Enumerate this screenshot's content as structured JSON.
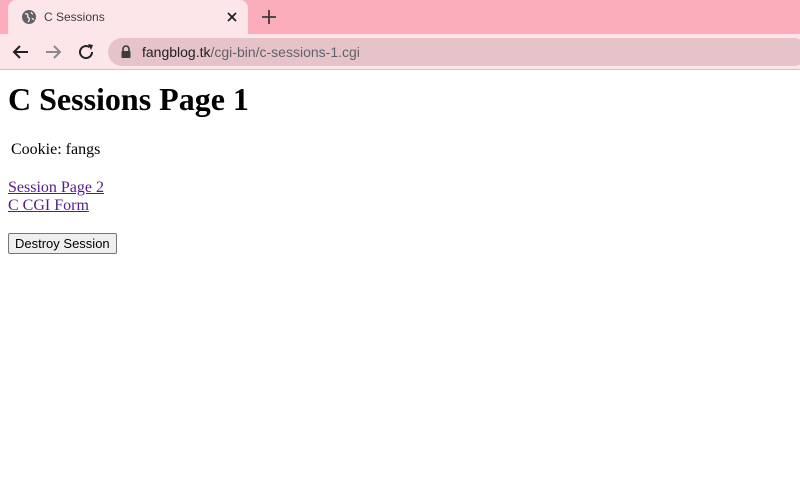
{
  "browser": {
    "tab": {
      "title": "C Sessions",
      "favicon": "globe-icon"
    },
    "toolbar": {
      "back_icon": "arrow-left-icon",
      "forward_icon": "arrow-right-icon",
      "reload_icon": "reload-icon"
    },
    "address": {
      "host": "fangblog.tk",
      "path": "/cgi-bin/c-sessions-1.cgi",
      "secure_icon": "lock-icon"
    },
    "colors": {
      "tabstrip": "#fbadbc",
      "active_tab": "#fde6ea",
      "omnibox": "#e5c3c9",
      "visited_link": "#551a8b"
    }
  },
  "page": {
    "heading": "C Sessions Page 1",
    "cookie_label": "Cookie:",
    "cookie_value": "fangs",
    "links": [
      "Session Page 2",
      "C CGI Form"
    ],
    "destroy_button": "Destroy Session"
  }
}
